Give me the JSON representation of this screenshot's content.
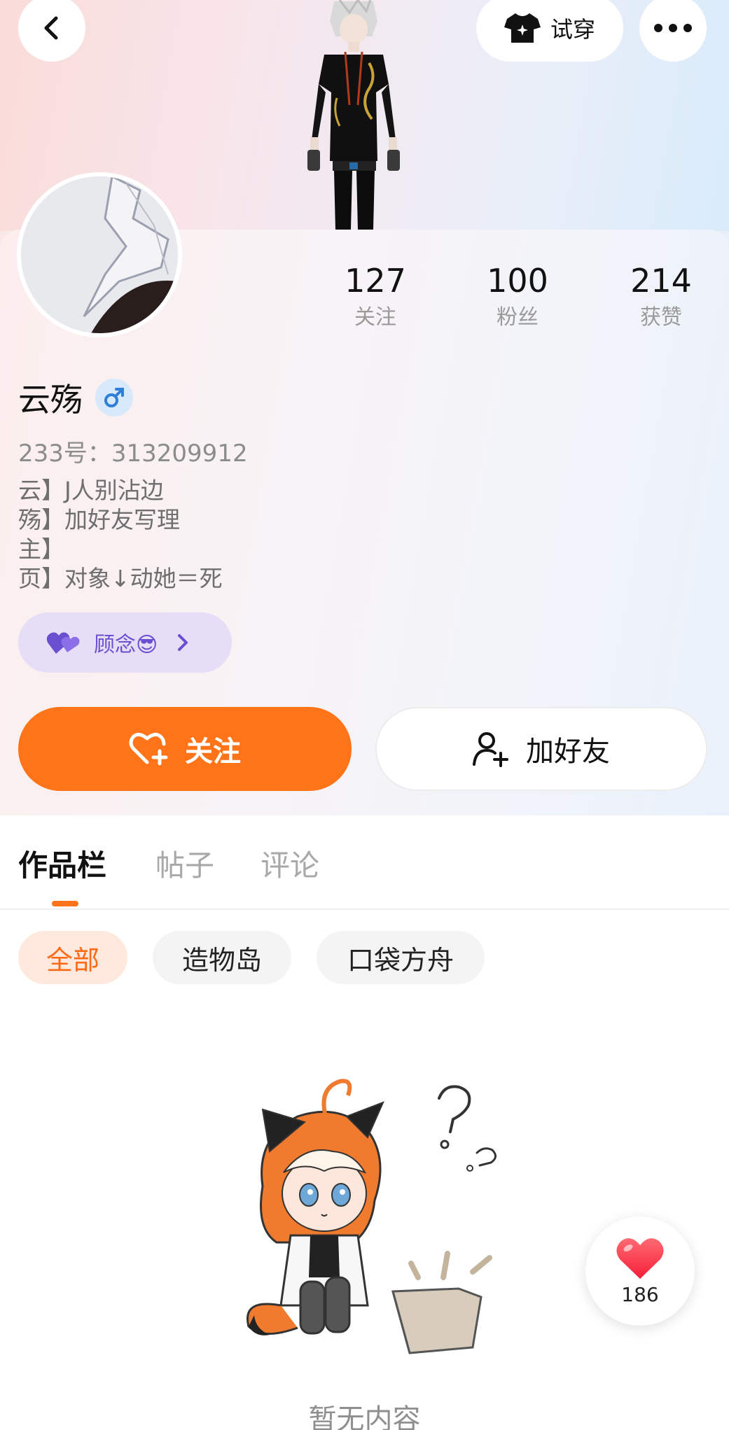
{
  "header": {
    "tryon_label": "试穿",
    "icons": [
      "chevron-left-icon",
      "tshirt-icon",
      "more-icon"
    ]
  },
  "profile": {
    "stats": [
      {
        "value": "127",
        "label": "关注"
      },
      {
        "value": "100",
        "label": "粉丝"
      },
      {
        "value": "214",
        "label": "获赞"
      }
    ],
    "nickname": "云殇",
    "gender_icon": "male-icon",
    "uid": "233号：313209912",
    "bio": [
      "云】J人别沾边",
      "殇】加好友写理",
      "主】",
      "页】对象↓动她＝死"
    ],
    "tag": {
      "icon": "double-heart-icon",
      "text": "顾念😎"
    }
  },
  "actions": {
    "follow_label": "关注",
    "add_friend_label": "加好友"
  },
  "tabs": [
    {
      "label": "作品栏",
      "active": true
    },
    {
      "label": "帖子",
      "active": false
    },
    {
      "label": "评论",
      "active": false
    }
  ],
  "filters": [
    {
      "label": "全部",
      "active": true
    },
    {
      "label": "造物岛",
      "active": false
    },
    {
      "label": "口袋方舟",
      "active": false
    }
  ],
  "empty_state": {
    "text": "暂无内容"
  },
  "like_fab": {
    "count": "186"
  },
  "colors": {
    "accent": "#ff7418",
    "tag_purple": "#6a4fd0",
    "like_red": "#ff3b4e"
  }
}
